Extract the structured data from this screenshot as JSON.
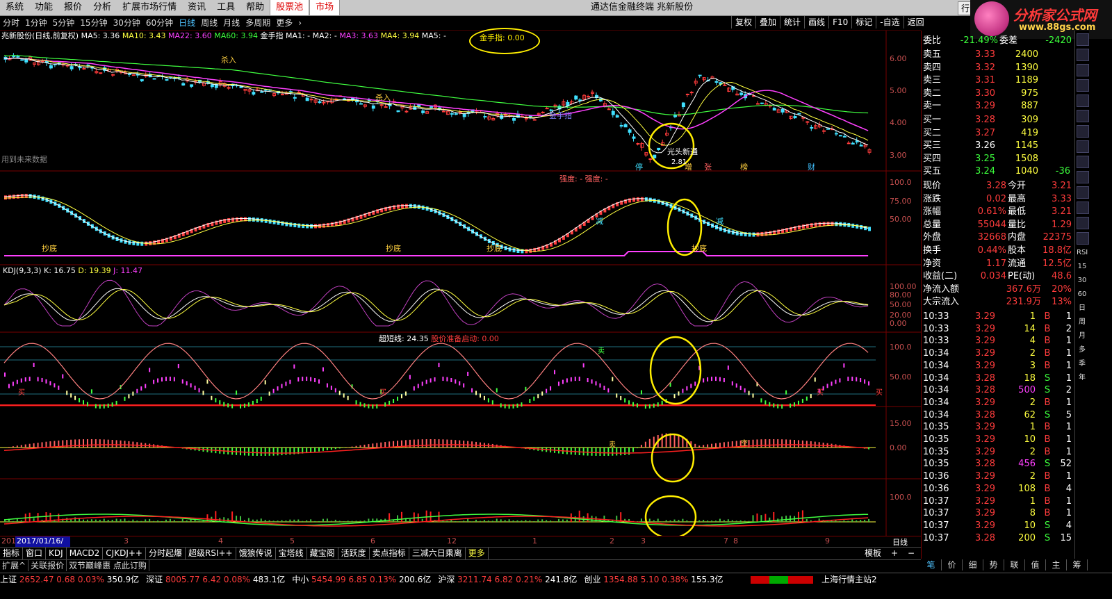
{
  "menu": {
    "items": [
      "系统",
      "功能",
      "报价",
      "分析",
      "扩展市场行情",
      "资讯",
      "工具",
      "帮助"
    ],
    "tabs": [
      "股票池",
      "市场"
    ],
    "app_title": "通达信金融终端  兆新股份",
    "window_tab": "行"
  },
  "logo": {
    "title": "分析家公式网",
    "url_text": "www.88gs.com"
  },
  "periods": [
    "分时",
    "1分钟",
    "5分钟",
    "15分钟",
    "30分钟",
    "60分钟",
    "日线",
    "周线",
    "月线",
    "多周期",
    "更多"
  ],
  "selected_period": "日线",
  "toolbar": [
    "复权",
    "叠加",
    "统计",
    "画线",
    "F10",
    "标记",
    "-自选",
    "返回"
  ],
  "info": {
    "stock": "兆新股份(日线,前复权)",
    "ma5": "MA5: 3.36",
    "ma10": "MA10: 3.43",
    "ma22": "MA22: 3.60",
    "ma60": "MA60: 3.94",
    "jsz": "金手指  MA1: -",
    "ma2": "MA2: -",
    "ma3": "MA3: 3.63",
    "ma4": "MA4: 3.94",
    "ma5b": "MA5: -",
    "jsz_val": "金手指: 0.00"
  },
  "main_panel": {
    "yticks": [
      "6.00",
      "5.00",
      "4.00",
      "3.00"
    ],
    "note": "用到未来数据",
    "labels": [
      "杀入",
      "杀入",
      "金手指",
      "光头新通",
      "2.81"
    ],
    "badges": [
      "停",
      "增",
      "张",
      "榜",
      "财"
    ]
  },
  "panel2": {
    "yticks": [
      "100.0",
      "75.00",
      "50.00"
    ],
    "title": "强度: -  强度: -",
    "marks": [
      "抄底",
      "抄底",
      "抄底",
      "抄底",
      "减",
      "减"
    ]
  },
  "panel3": {
    "title": "KDJ(9,3,3)",
    "k": "K: 16.75",
    "d": "D: 19.39",
    "j": "J: 11.47",
    "yticks": [
      "100.00",
      "80.00",
      "50.00",
      "20.00",
      "0.00"
    ]
  },
  "panel4": {
    "title_a": "超短线: 24.35",
    "title_b": "股价准备启动: 0.00",
    "yticks": [
      "100.0",
      "50.00"
    ],
    "marks": [
      "买",
      "买",
      "卖",
      "买",
      "买"
    ]
  },
  "panel5": {
    "yticks": [
      "15.00",
      "0.00"
    ],
    "marks": [
      "卖",
      "空"
    ]
  },
  "panel6": {
    "yticks": [
      "100.0"
    ]
  },
  "dates": {
    "start": "2017/01/16/—",
    "lead": "201",
    "ticks": [
      "3",
      "4",
      "5",
      "6",
      "12",
      "1",
      "2",
      "3",
      "7",
      "8",
      "9"
    ],
    "right": "日线"
  },
  "indicator_tabs": [
    "指标",
    "窗口",
    "KDJ",
    "MACD2",
    "CJKDJ++",
    "分时起爆",
    "超级RSI++",
    "饿狼传说",
    "宝塔线",
    "藏宝阁",
    "活跃度",
    "卖点指标",
    "三减六日乘离",
    "更多"
  ],
  "ext_tabs": [
    "扩展^",
    "关联报价",
    "双节巅峰惠 点此订购"
  ],
  "template_btn": "模板",
  "quote": {
    "weibi": {
      "label": "委比",
      "val": "-21.49%",
      "label2": "委差",
      "val2": "-2420"
    },
    "sell": [
      {
        "label": "卖五",
        "price": "3.33",
        "vol": "2400"
      },
      {
        "label": "卖四",
        "price": "3.32",
        "vol": "1390"
      },
      {
        "label": "卖三",
        "price": "3.31",
        "vol": "1189"
      },
      {
        "label": "卖二",
        "price": "3.30",
        "vol": "975"
      },
      {
        "label": "卖一",
        "price": "3.29",
        "vol": "887"
      }
    ],
    "buy": [
      {
        "label": "买一",
        "price": "3.28",
        "vol": "309",
        "ext": ""
      },
      {
        "label": "买二",
        "price": "3.27",
        "vol": "419",
        "ext": ""
      },
      {
        "label": "买三",
        "price": "3.26",
        "vol": "1145",
        "ext": ""
      },
      {
        "label": "买四",
        "price": "3.25",
        "vol": "1508",
        "ext": ""
      },
      {
        "label": "买五",
        "price": "3.24",
        "vol": "1040",
        "ext": "-36"
      }
    ],
    "stats": [
      {
        "l1": "现价",
        "v1": "3.28",
        "l2": "今开",
        "v2": "3.21"
      },
      {
        "l1": "涨跌",
        "v1": "0.02",
        "l2": "最高",
        "v2": "3.33"
      },
      {
        "l1": "涨幅",
        "v1": "0.61%",
        "l2": "最低",
        "v2": "3.21"
      },
      {
        "l1": "总量",
        "v1": "55044",
        "l2": "量比",
        "v2": "1.29"
      },
      {
        "l1": "外盘",
        "v1": "32668",
        "l2": "内盘",
        "v2": "22375"
      },
      {
        "l1": "换手",
        "v1": "0.44%",
        "l2": "股本",
        "v2": "18.8亿"
      },
      {
        "l1": "净资",
        "v1": "1.17",
        "l2": "流通",
        "v2": "12.5亿"
      },
      {
        "l1": "收益(二)",
        "v1": "0.034",
        "l2": "PE(动)",
        "v2": "48.6"
      }
    ],
    "flow": [
      {
        "l": "净流入额",
        "v": "367.6万",
        "p": "20%"
      },
      {
        "l": "大宗流入",
        "v": "231.9万",
        "p": "13%"
      }
    ],
    "ticks": [
      {
        "t": "10:33",
        "p": "3.29",
        "v": "1",
        "s": "B",
        "n": "1"
      },
      {
        "t": "10:33",
        "p": "3.29",
        "v": "14",
        "s": "B",
        "n": "2"
      },
      {
        "t": "10:33",
        "p": "3.29",
        "v": "4",
        "s": "B",
        "n": "1"
      },
      {
        "t": "10:34",
        "p": "3.29",
        "v": "2",
        "s": "B",
        "n": "1"
      },
      {
        "t": "10:34",
        "p": "3.29",
        "v": "3",
        "s": "B",
        "n": "1"
      },
      {
        "t": "10:34",
        "p": "3.28",
        "v": "18",
        "s": "S",
        "n": "1"
      },
      {
        "t": "10:34",
        "p": "3.28",
        "v": "500",
        "s": "S",
        "n": "2"
      },
      {
        "t": "10:34",
        "p": "3.29",
        "v": "2",
        "s": "B",
        "n": "1"
      },
      {
        "t": "10:34",
        "p": "3.28",
        "v": "62",
        "s": "S",
        "n": "5"
      },
      {
        "t": "10:35",
        "p": "3.29",
        "v": "1",
        "s": "B",
        "n": "1"
      },
      {
        "t": "10:35",
        "p": "3.29",
        "v": "10",
        "s": "B",
        "n": "1"
      },
      {
        "t": "10:35",
        "p": "3.29",
        "v": "2",
        "s": "B",
        "n": "1"
      },
      {
        "t": "10:35",
        "p": "3.28",
        "v": "456",
        "s": "S",
        "n": "52"
      },
      {
        "t": "10:36",
        "p": "3.29",
        "v": "2",
        "s": "B",
        "n": "1"
      },
      {
        "t": "10:36",
        "p": "3.29",
        "v": "108",
        "s": "B",
        "n": "4"
      },
      {
        "t": "10:37",
        "p": "3.29",
        "v": "1",
        "s": "B",
        "n": "1"
      },
      {
        "t": "10:37",
        "p": "3.29",
        "v": "8",
        "s": "B",
        "n": "1"
      },
      {
        "t": "10:37",
        "p": "3.29",
        "v": "10",
        "s": "S",
        "n": "4"
      },
      {
        "t": "10:37",
        "p": "3.28",
        "v": "200",
        "s": "S",
        "n": "15"
      }
    ]
  },
  "side_tabs": [
    "笔",
    "价",
    "细",
    "势",
    "联",
    "值",
    "主",
    "筹"
  ],
  "vbar_icons": [
    "RSI",
    "15",
    "30",
    "60",
    "日",
    "周",
    "月",
    "多",
    "季",
    "年"
  ],
  "status": {
    "indices": [
      {
        "name": "上证",
        "val": "2652.47",
        "chg": "0.68",
        "pct": "0.03%",
        "amt": "350.9亿"
      },
      {
        "name": "深证",
        "val": "8005.77",
        "chg": "6.42",
        "pct": "0.08%",
        "amt": "483.1亿"
      },
      {
        "name": "中小",
        "val": "5454.99",
        "chg": "6.85",
        "pct": "0.13%",
        "amt": "200.6亿"
      },
      {
        "name": "沪深",
        "val": "3211.74",
        "chg": "6.82",
        "pct": "0.21%",
        "amt": "241.8亿"
      },
      {
        "name": "创业",
        "val": "1354.88",
        "chg": "5.10",
        "pct": "0.38%",
        "amt": "155.3亿"
      }
    ],
    "server": "上海行情主站2"
  },
  "colors": {
    "up": "#ff3c3c",
    "down": "#3cff3c",
    "ma5": "#ffffff",
    "ma10": "#ffff00",
    "ma22": "#ff40ff",
    "ma60": "#40ff40",
    "bg": "#000000",
    "grid": "#700000"
  }
}
